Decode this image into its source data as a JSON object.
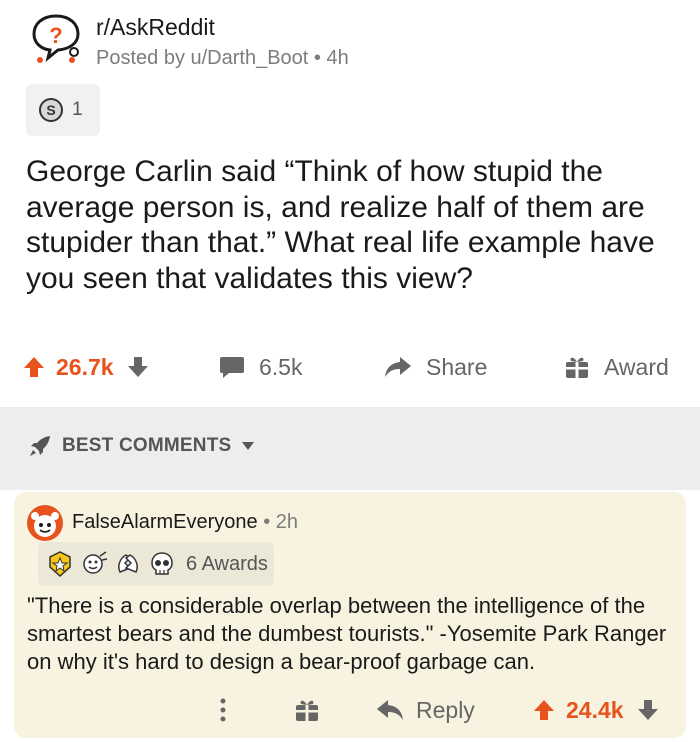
{
  "post": {
    "subreddit": "r/AskReddit",
    "posted_by": "Posted by u/Darth_Boot",
    "age": "4h",
    "award_count": "1",
    "title": "George Carlin said “Think of how stupid the average person is, and realize half of them are stupider than that.” What real life example have you seen that validates this view?"
  },
  "actions": {
    "upvotes": "26.7k",
    "comments": "6.5k",
    "share_label": "Share",
    "award_label": "Award"
  },
  "sort": {
    "label": "BEST COMMENTS"
  },
  "comment": {
    "username": "FalseAlarmEveryone",
    "age": "2h",
    "awards_label": "6 Awards",
    "text": "\"There is a considerable overlap between the intelligence of the smartest bears and the dumbest tourists.\" -Yosemite Park Ranger on why it's hard to design a bear-proof garbage can.",
    "reply_label": "Reply",
    "upvotes": "24.4k"
  },
  "colors": {
    "upvote": "#e8521c",
    "text_muted": "#7c7c7c",
    "comment_bg": "#f8f3e0",
    "band_bg": "#ededed"
  },
  "icons": [
    "askreddit-snoo-icon",
    "silver-award-icon",
    "upvote-arrow-icon",
    "downvote-arrow-icon",
    "comment-bubble-icon",
    "share-arrow-icon",
    "gift-icon",
    "rocket-icon",
    "caret-down-icon",
    "avatar-icon",
    "more-dots-icon",
    "reply-arrow-icon"
  ]
}
